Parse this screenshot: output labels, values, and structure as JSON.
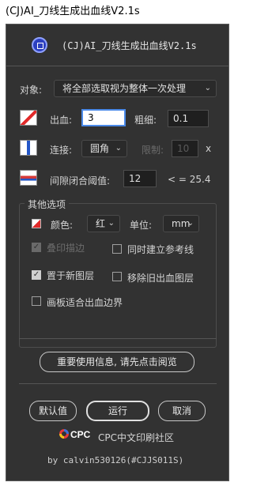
{
  "window": {
    "title": "(CJ)AI_刀线生成出血线V2.1s"
  },
  "header": {
    "title": "(CJ)AI_刀线生成出血线V2.1s",
    "icon": "ai-badge-icon"
  },
  "object": {
    "label": "对象:",
    "value": "将全部选取视为整体一次处理"
  },
  "bleed": {
    "label": "出血:",
    "value": "3",
    "thickness_label": "粗细:",
    "thickness_value": "0.1"
  },
  "connect": {
    "label": "连接:",
    "value": "圆角",
    "limit_label": "限制:",
    "limit_value": "10",
    "limit_suffix": "x"
  },
  "gap": {
    "label": "间隙闭合阈值:",
    "value": "12",
    "note": "< = 25.4"
  },
  "other_options": {
    "title": "其他选项",
    "color_label": "颜色:",
    "color_value": "红",
    "unit_label": "单位:",
    "unit_value": "mm",
    "overprint_label": "叠印描边",
    "overprint_checked": true,
    "ref_layer_label": "同时建立参考线",
    "ref_layer_checked": false,
    "new_layer_label": "置于新图层",
    "new_layer_checked": true,
    "remove_old_label": "移除旧出血图层",
    "remove_old_checked": false,
    "fit_artboard_label": "画板适合出血边界",
    "fit_artboard_checked": false
  },
  "info_button": "重要使用信息, 请先点击阅览",
  "buttons": {
    "default": "默认值",
    "run": "运行",
    "cancel": "取消"
  },
  "footer": {
    "brand": "CPC",
    "community": "CPC中文印刷社区",
    "credit": "by calvin530126(#CJJS011S)"
  },
  "colors": {
    "panel_bg": "#323232",
    "focus_border": "#4b8ae8",
    "swatch_red": "#e12a2a"
  }
}
